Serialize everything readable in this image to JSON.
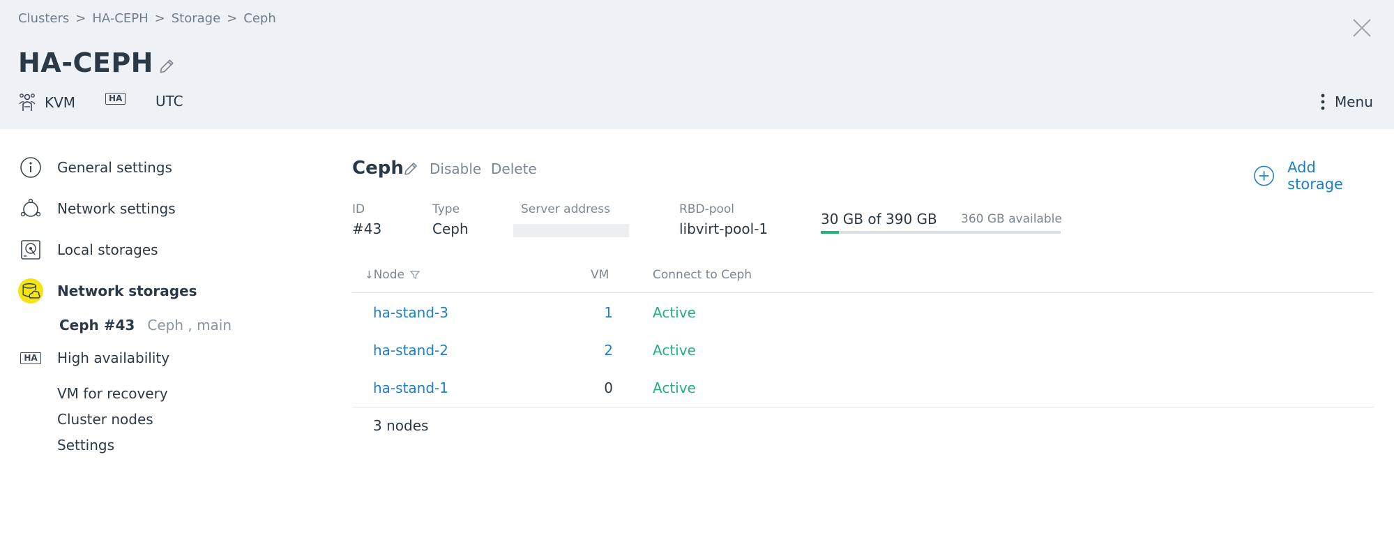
{
  "header": {
    "breadcrumb": [
      {
        "label": "Clusters"
      },
      {
        "label": "HA-CEPH"
      },
      {
        "label": "Storage"
      },
      {
        "label": "Ceph"
      }
    ],
    "breadcrumb_separator": ">",
    "title": "HA-CEPH",
    "meta": {
      "virtualization": "KVM",
      "ha_badge": "HA",
      "timezone": "UTC"
    },
    "menu_label": "Menu"
  },
  "sidebar": {
    "items": [
      {
        "label": "General settings",
        "icon": "info-icon"
      },
      {
        "label": "Network settings",
        "icon": "network-icon"
      },
      {
        "label": "Local storages",
        "icon": "local-storage-icon"
      },
      {
        "label": "Network storages",
        "icon": "network-storage-icon",
        "active": true
      },
      {
        "label": "High availability",
        "icon": "ha-icon"
      }
    ],
    "network_storage_sub": {
      "name": "Ceph #43",
      "detail": "Ceph , main"
    },
    "ha_sub": [
      {
        "label": "VM for recovery"
      },
      {
        "label": "Cluster nodes"
      },
      {
        "label": "Settings"
      }
    ]
  },
  "storage": {
    "title": "Ceph",
    "disable_label": "Disable",
    "delete_label": "Delete",
    "add_storage_label": "Add storage",
    "fields": {
      "id_label": "ID",
      "id_value": "#43",
      "type_label": "Type",
      "type_value": "Ceph",
      "server_label": "Server address",
      "pool_label": "RBD-pool",
      "pool_value": "libvirt-pool-1"
    },
    "usage": {
      "text": "30 GB of 390 GB",
      "available": "360 GB available",
      "used_gb": 30,
      "total_gb": 390
    }
  },
  "table": {
    "columns": {
      "node": "Node",
      "vm": "VM",
      "connect": "Connect to Ceph"
    },
    "sort_arrow": "↓",
    "rows": [
      {
        "node": "ha-stand-3",
        "vm": "1",
        "status": "Active"
      },
      {
        "node": "ha-stand-2",
        "vm": "2",
        "status": "Active"
      },
      {
        "node": "ha-stand-1",
        "vm": "0",
        "status": "Active"
      }
    ],
    "footer": "3 nodes"
  },
  "colors": {
    "header_bg": "#eef2f6",
    "link": "#1f7fc4",
    "active": "#25b07e",
    "highlight": "#f5e414"
  }
}
